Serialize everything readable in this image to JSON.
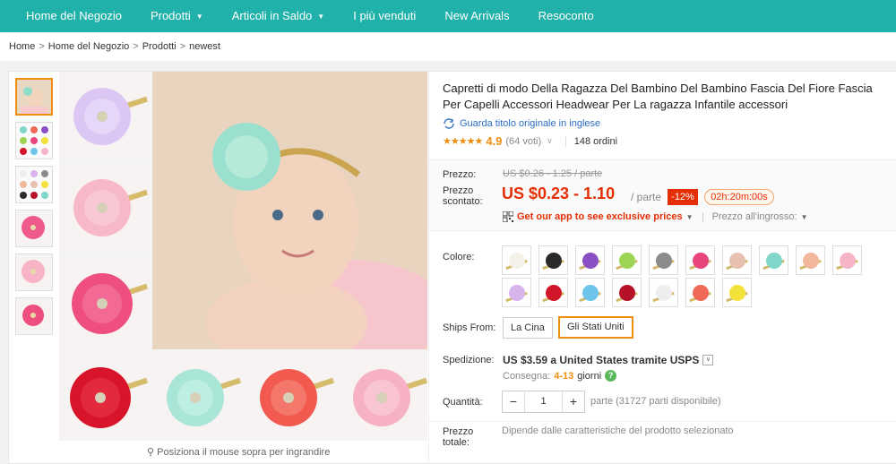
{
  "nav": {
    "items": [
      {
        "label": "Home del Negozio",
        "caret": false
      },
      {
        "label": "Prodotti",
        "caret": true
      },
      {
        "label": "Articoli in Saldo",
        "caret": true
      },
      {
        "label": "I più venduti",
        "caret": false
      },
      {
        "label": "New Arrivals",
        "caret": false
      },
      {
        "label": "Resoconto",
        "caret": false
      }
    ],
    "background": "#20b2aa"
  },
  "breadcrumb": {
    "items": [
      "Home",
      "Home del Negozio",
      "Prodotti",
      "newest"
    ],
    "separator": ">"
  },
  "gallery": {
    "zoom_hint": "Posiziona il mouse sopra per ingrandire",
    "thumbnail_count": 6
  },
  "product": {
    "title": "Capretti di modo Della Ragazza Del Bambino Del Bambino Fascia Del Fiore Fascia Per Capelli Accessori Headwear Per La ragazza Infantile accessori",
    "translate_link": "Guarda titolo originale in inglese",
    "stars": "★★★★★",
    "rating": "4.9",
    "votes": "(64 voti)",
    "orders": "148 ordini"
  },
  "price": {
    "label": "Prezzo:",
    "old": "US $0.26 - 1.25 / parte",
    "discount_label": "Prezzo scontato:",
    "new": "US $0.23 - 1.10",
    "unit": "/ parte",
    "discount": "-12%",
    "countdown": "02h:20m:00s",
    "app_promo": "Get our app to see exclusive prices",
    "wholesale": "Prezzo all'ingrosso:"
  },
  "options": {
    "color_label": "Colore:",
    "colors": [
      "#f4f1e8",
      "#2a2a2a",
      "#8a4fc2",
      "#9ed454",
      "#8b8b8b",
      "#e8457b",
      "#e8c0b0",
      "#7fd6c9",
      "#f3b79c",
      "#f6b5c6",
      "#d8b4ec",
      "#d2162a",
      "#6ec3e8",
      "#b5122a",
      "#eeeeee",
      "#f06a5a",
      "#f3e23a"
    ],
    "ships_from_label": "Ships From:",
    "ships_from": [
      "La Cina",
      "Gli Stati Uniti"
    ],
    "ships_from_selected": 1,
    "shipping_label": "Spedizione:",
    "shipping": "US $3.59 a United States tramite USPS",
    "delivery_prefix": "Consegna:",
    "delivery_days": "4-13",
    "delivery_unit": "giorni",
    "quantity_label": "Quantità:",
    "quantity": "1",
    "availability": "parte (31727 parti disponibile)",
    "total_label": "Prezzo totale:",
    "total_text": "Dipende dalle caratteristiche del prodotto selezionato"
  },
  "colors": {
    "accent": "#f08e12",
    "price_red": "#e62e04",
    "link_blue": "#2b6dc2"
  }
}
